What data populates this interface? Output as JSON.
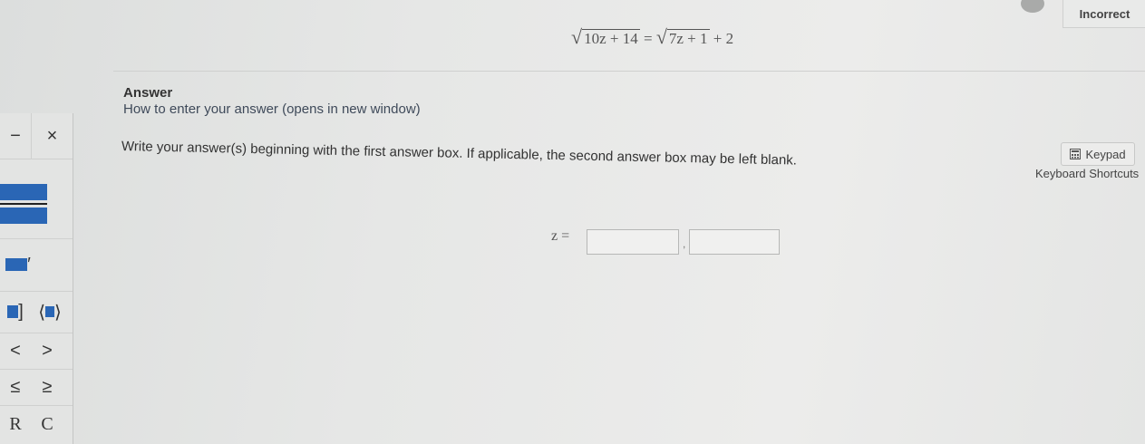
{
  "header": {
    "status_label": "Incorrect"
  },
  "equation": {
    "left_radicand": "10z + 14",
    "equals": "=",
    "right_radicand": "7z + 1",
    "right_tail": "+ 2"
  },
  "answer_section": {
    "heading": "Answer",
    "howto_link": "How to enter your answer (opens in new window)",
    "instructions": "Write your answer(s) beginning with the first answer box. If applicable, the second answer box may be left blank.",
    "variable_label": "z =",
    "separator": ",",
    "answer_boxes": [
      {
        "value": ""
      },
      {
        "value": ""
      }
    ]
  },
  "tools": {
    "keypad_label": "Keypad",
    "shortcuts_label": "Keyboard Shortcuts"
  },
  "math_keypad": {
    "minus": "−",
    "times": "×",
    "prime": "′",
    "bracket_close": "]",
    "angle_open": "⟨",
    "angle_close": "⟩",
    "less_than": "<",
    "greater_than": ">",
    "leq": "≤",
    "geq": "≥",
    "reals": "R",
    "complex": "C"
  },
  "icons": [
    "keypad-icon",
    "status-circle-icon"
  ]
}
